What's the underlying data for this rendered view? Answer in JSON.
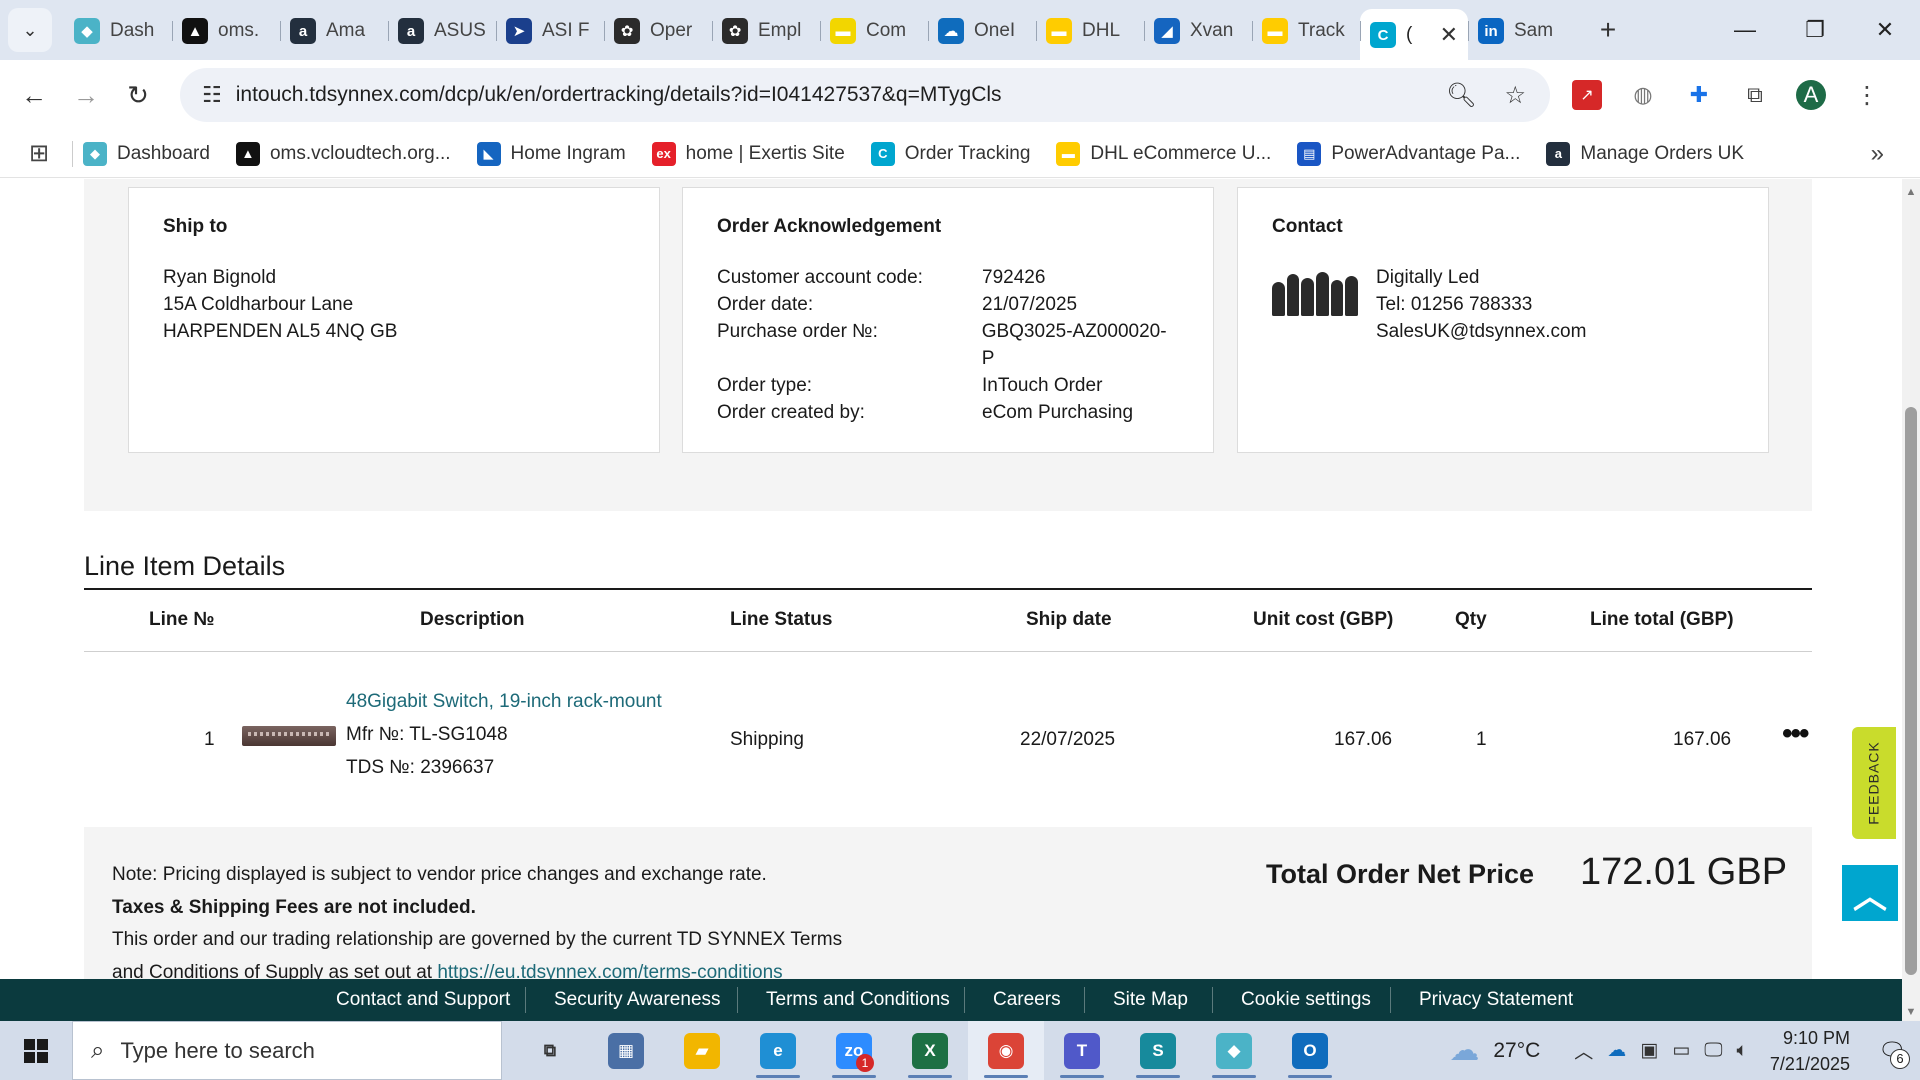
{
  "browser": {
    "tabs": [
      {
        "title": "Dash",
        "icon": "diamond-icon",
        "color": "#4bb3c7"
      },
      {
        "title": "oms.",
        "icon": "triangle-logo-icon",
        "color": "#111111"
      },
      {
        "title": "Ama",
        "icon": "amazon-icon",
        "color": "#232f3e"
      },
      {
        "title": "ASUS",
        "icon": "amazon-icon",
        "color": "#232f3e"
      },
      {
        "title": "ASI F",
        "icon": "arrow-logo-icon",
        "color": "#1b3f8c"
      },
      {
        "title": "Oper",
        "icon": "openai-icon",
        "color": "#2b2b2b"
      },
      {
        "title": "Empl",
        "icon": "openai-icon",
        "color": "#2b2b2b"
      },
      {
        "title": "Com",
        "icon": "note-icon",
        "color": "#f2d600"
      },
      {
        "title": "OneI",
        "icon": "cloud-icon",
        "color": "#0f6cbd"
      },
      {
        "title": "DHL",
        "icon": "dhl-icon",
        "color": "#ffcc00"
      },
      {
        "title": "Xvan",
        "icon": "xvantage-icon",
        "color": "#1565c0"
      },
      {
        "title": "Track",
        "icon": "dhl-icon",
        "color": "#ffcc00"
      },
      {
        "title": "(",
        "icon": "tdsynnex-icon",
        "color": "#00a6cf",
        "active": true
      },
      {
        "title": "Sam",
        "icon": "linkedin-icon",
        "color": "#0a66c2"
      }
    ],
    "url": "intouch.tdsynnex.com/dcp/uk/en/ordertracking/details?id=I041427537&q=MTygCls",
    "avatar_letter": "A",
    "bookmarks": [
      {
        "label": "Dashboard",
        "icon": "diamond-icon",
        "color": "#4bb3c7"
      },
      {
        "label": "oms.vcloudtech.org...",
        "icon": "triangle-logo-icon",
        "color": "#111111"
      },
      {
        "label": "Home Ingram",
        "icon": "ingram-icon",
        "color": "#1565c0"
      },
      {
        "label": "home | Exertis Site",
        "icon": "exertis-icon",
        "color": "#e5202a"
      },
      {
        "label": "Order Tracking",
        "icon": "tdsynnex-icon",
        "color": "#00a6cf"
      },
      {
        "label": "DHL eCommerce U...",
        "icon": "dhl-icon",
        "color": "#ffcc00"
      },
      {
        "label": "PowerAdvantage Pa...",
        "icon": "document-icon",
        "color": "#1a56c4"
      },
      {
        "label": "Manage Orders UK",
        "icon": "amazon-icon",
        "color": "#232f3e"
      }
    ]
  },
  "ship_to": {
    "title": "Ship to",
    "lines": [
      "Ryan Bignold",
      "15A Coldharbour Lane",
      "HARPENDEN AL5 4NQ GB"
    ]
  },
  "order_ack": {
    "title": "Order Acknowledgement",
    "rows": [
      {
        "k": "Customer account code:",
        "v": "792426"
      },
      {
        "k": "Order date:",
        "v": "21/07/2025"
      },
      {
        "k": "Purchase order №:",
        "v": "GBQ3025-AZ000020-P"
      },
      {
        "k": "Order type:",
        "v": "InTouch Order"
      },
      {
        "k": "Order created by:",
        "v": "eCom Purchasing"
      }
    ]
  },
  "contact": {
    "title": "Contact",
    "name": "Digitally Led",
    "tel": "Tel: 01256 788333",
    "email": "SalesUK@tdsynnex.com"
  },
  "line_items": {
    "title": "Line Item Details",
    "headers": [
      "Line №",
      "Description",
      "Line Status",
      "Ship date",
      "Unit cost (GBP)",
      "Qty",
      "Line total (GBP)"
    ],
    "rows": [
      {
        "line": "1",
        "description": "48Gigabit Switch, 19-inch rack-mount",
        "mfr": "Mfr №: TL-SG1048",
        "tds": "TDS №: 2396637",
        "status": "Shipping",
        "ship_date": "22/07/2025",
        "unit_cost": "167.06",
        "qty": "1",
        "line_total": "167.06"
      }
    ]
  },
  "notes": {
    "pricing": "Note: Pricing displayed is subject to vendor price changes and exchange rate.",
    "taxes": "Taxes & Shipping Fees are not included.",
    "terms_1": "This order and our trading relationship are governed by the current TD SYNNEX Terms",
    "terms_2": "and Conditions of Supply as set out at",
    "terms_link": "https://eu.tdsynnex.com/terms-conditions"
  },
  "total": {
    "label": "Total Order Net Price",
    "value": "172.01 GBP"
  },
  "feedback_label": "FEEDBACK",
  "footer": [
    "Contact and Support",
    "Security Awareness",
    "Terms and Conditions",
    "Careers",
    "Site Map",
    "Cookie settings",
    "Privacy Statement"
  ],
  "taskbar": {
    "search_placeholder": "Type here to search",
    "weather": "27°C",
    "time": "9:10 PM",
    "date": "7/21/2025",
    "notifications": "6",
    "zoom_badge": "1",
    "apps": [
      {
        "name": "task-view-icon",
        "color": "#d3dcea"
      },
      {
        "name": "calculator-icon",
        "color": "#4a6fa5"
      },
      {
        "name": "file-explorer-icon",
        "color": "#f2b600"
      },
      {
        "name": "edge-icon",
        "color": "#1f8fd4"
      },
      {
        "name": "zoom-icon",
        "color": "#2d8cff"
      },
      {
        "name": "excel-icon",
        "color": "#1d7044"
      },
      {
        "name": "chrome-icon",
        "color": "#db4437"
      },
      {
        "name": "teams-icon",
        "color": "#5059c9"
      },
      {
        "name": "surfshark-icon",
        "color": "#178a9c"
      },
      {
        "name": "diamond-app-icon",
        "color": "#4bb3c7"
      },
      {
        "name": "outlook-icon",
        "color": "#0f6cbd"
      }
    ]
  }
}
